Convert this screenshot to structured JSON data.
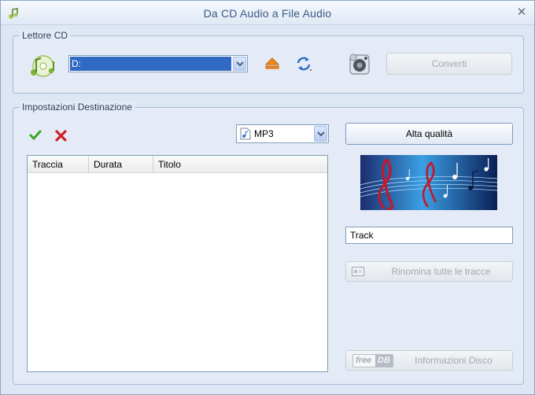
{
  "window": {
    "title": "Da CD Audio a File Audio"
  },
  "cd_group": {
    "label": "Lettore CD",
    "drive": "D:",
    "convert_label": "Converti"
  },
  "dest_group": {
    "label": "Impostazioni Destinazione",
    "format": "MP3",
    "hq_label": "Alta qualità",
    "columns": [
      "Traccia",
      "Durata",
      "Titolo"
    ],
    "rows": [],
    "track_name": "Track",
    "rename_label": "Rinomina tutte le tracce",
    "freedb_logo_free": "free",
    "freedb_logo_db": "DB",
    "freedb_label": "Informazioni Disco"
  },
  "icons": {
    "app": "music-note-icon",
    "close": "close-icon",
    "cd": "music-cd-icon",
    "eject": "eject-icon",
    "refresh": "refresh-icon",
    "speaker": "speaker-icon",
    "check": "check-icon",
    "remove": "x-icon"
  },
  "colors": {
    "accent": "#316ac5",
    "check": "#3aa524",
    "remove": "#d02121",
    "eject": "#f08a1c"
  }
}
